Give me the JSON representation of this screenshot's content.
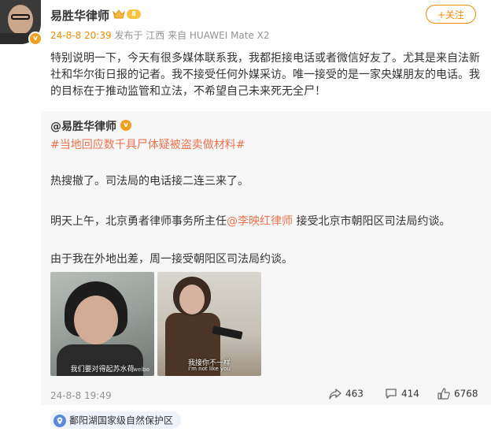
{
  "author": {
    "name": "易胜华律师",
    "level_badge": "8",
    "verified_mark": "v",
    "avatar_icon": "user-avatar"
  },
  "follow_button": "+关注",
  "meta": {
    "time": "24-8-8 20:39",
    "from_location": "发布于 江西",
    "device": "来自 HUAWEI Mate X2"
  },
  "post_text": "特别说明一下，今天有很多媒体联系我，我都拒接电话或者微信好友了。尤其是来自法新社和华尔街日报的记者。我不接受任何外媒采访。唯一接受的是一家央媒朋友的电话。我的目标在于推动监管和立法，不希望自己未来死无全尸！",
  "repost": {
    "user": "@易胜华律师",
    "topic": "#当地回应数千具尸体疑被盗卖做材料#",
    "line1": "热搜撤了。司法局的电话接二连三来了。",
    "line2_prefix": "明天上午，北京勇者律师事务所主任",
    "line2_mention": "@李映红律师",
    "line2_suffix": " 接受北京市朝阳区司法局约谈。",
    "line3": "由于我在外地出差，周一接受朝阳区司法局约谈。",
    "images": [
      {
        "caption": "我们要对得起苏水荷",
        "icon": "drama-still-photo"
      },
      {
        "caption": "我接你不一样",
        "caption2": "I'm not like you",
        "icon": "drama-still-photo"
      }
    ],
    "time": "24-8-8 19:49",
    "reposts": "463",
    "comments": "414",
    "likes": "6768",
    "location": "鄱阳湖国家级自然保护区"
  },
  "colors": {
    "accent_orange": "#f08c00",
    "link": "#eb7350",
    "repost_bg": "#f7f7f7"
  }
}
